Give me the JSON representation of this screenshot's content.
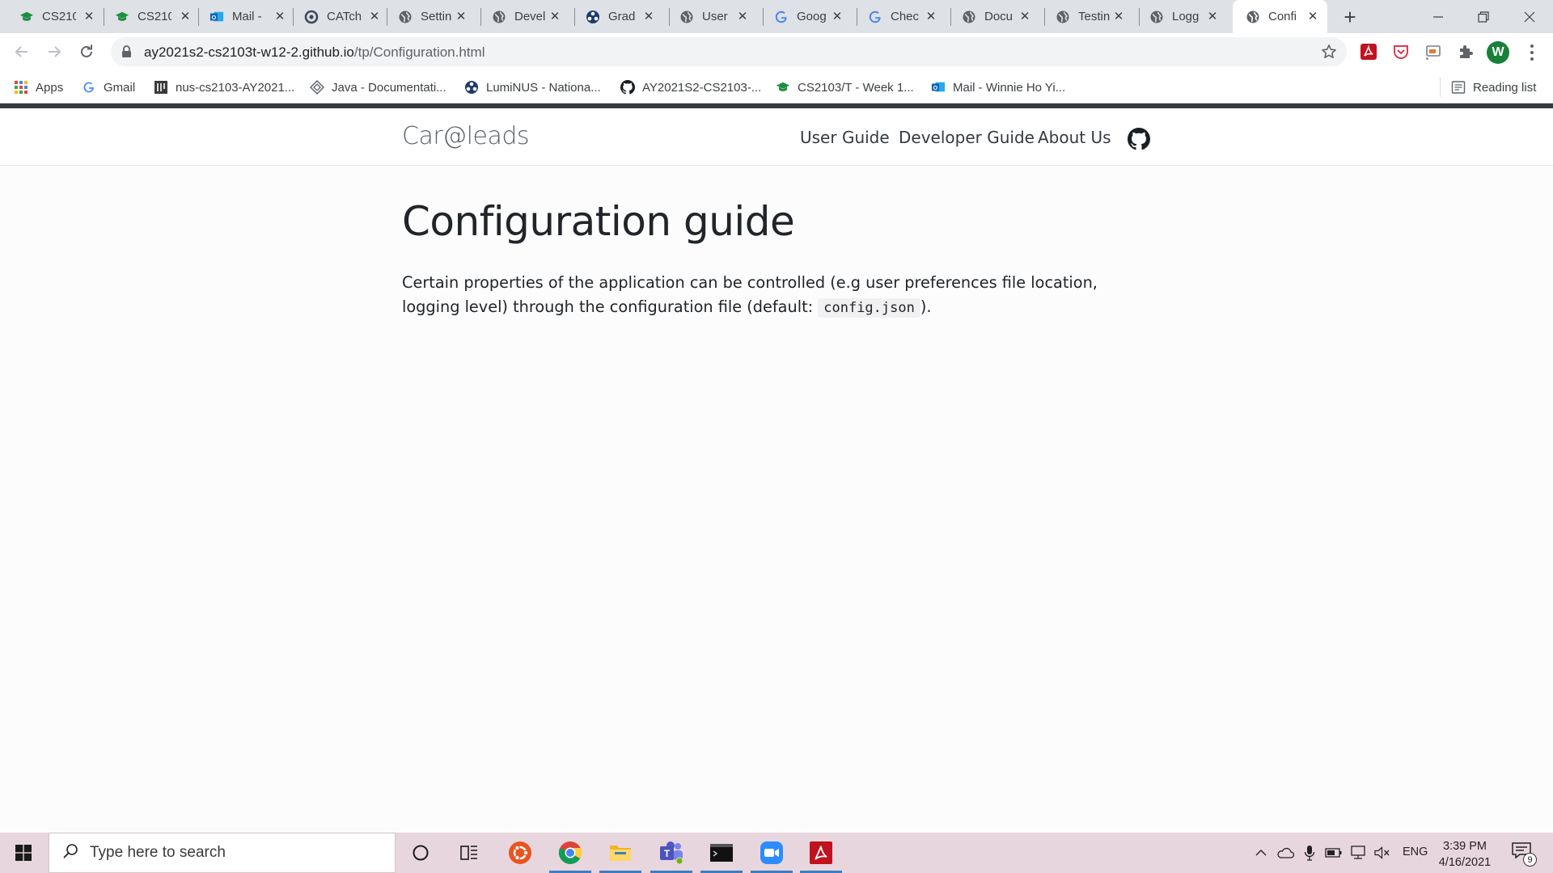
{
  "browser": {
    "tabs": [
      {
        "title": "CS210",
        "icon": "graduation-cap-icon",
        "active": false
      },
      {
        "title": "CS210",
        "icon": "graduation-cap-icon",
        "active": false
      },
      {
        "title": "Mail -",
        "icon": "outlook-icon",
        "active": false
      },
      {
        "title": "CATch",
        "icon": "catcher-icon",
        "active": false
      },
      {
        "title": "Settin",
        "icon": "globe-icon",
        "active": false
      },
      {
        "title": "Devel",
        "icon": "globe-icon",
        "active": false
      },
      {
        "title": "Grad",
        "icon": "luminus-icon",
        "active": false
      },
      {
        "title": "User",
        "icon": "globe-icon",
        "active": false
      },
      {
        "title": "Goog",
        "icon": "google-icon",
        "active": false
      },
      {
        "title": "Chec",
        "icon": "google-icon",
        "active": false
      },
      {
        "title": "Docu",
        "icon": "globe-icon",
        "active": false
      },
      {
        "title": "Testin",
        "icon": "globe-icon",
        "active": false
      },
      {
        "title": "Logg",
        "icon": "globe-icon",
        "active": false
      },
      {
        "title": "Confi",
        "icon": "globe-icon",
        "active": true
      }
    ],
    "address": {
      "domain": "ay2021s2-cs2103t-w12-2.github.io",
      "path": "/tp/Configuration.html"
    },
    "profile_initial": "W",
    "bookmarks": [
      {
        "label": "Apps",
        "icon": "apps-grid-icon"
      },
      {
        "label": "Gmail",
        "icon": "google-icon"
      },
      {
        "label": "nus-cs2103-AY2021...",
        "icon": "nus-icon"
      },
      {
        "label": "Java - Documentati...",
        "icon": "java-icon"
      },
      {
        "label": "LumiNUS - Nationa...",
        "icon": "luminus-icon"
      },
      {
        "label": "AY2021S2-CS2103-...",
        "icon": "github-icon"
      },
      {
        "label": "CS2103/T - Week 1...",
        "icon": "graduation-cap-icon"
      },
      {
        "label": "Mail - Winnie Ho Yi...",
        "icon": "outlook-icon"
      }
    ],
    "reading_list": "Reading list"
  },
  "site": {
    "brand": "Car@leads",
    "nav": [
      "User Guide",
      "Developer Guide",
      "About Us"
    ]
  },
  "content": {
    "title": "Configuration guide",
    "para_part1": "Certain properties of the application can be controlled (e.g user preferences file location, logging level) through the configuration file (default: ",
    "code": "config.json",
    "para_part2": ")."
  },
  "taskbar": {
    "search_placeholder": "Type here to search",
    "language": "ENG",
    "time": "3:39 PM",
    "date": "4/16/2021",
    "notification_count": "9"
  },
  "colors": {
    "tabstrip": "#dee1e6",
    "page_bg": "#fcfcfc",
    "taskbar": "#e8d6de",
    "accent_running": "#3d7ec4"
  }
}
